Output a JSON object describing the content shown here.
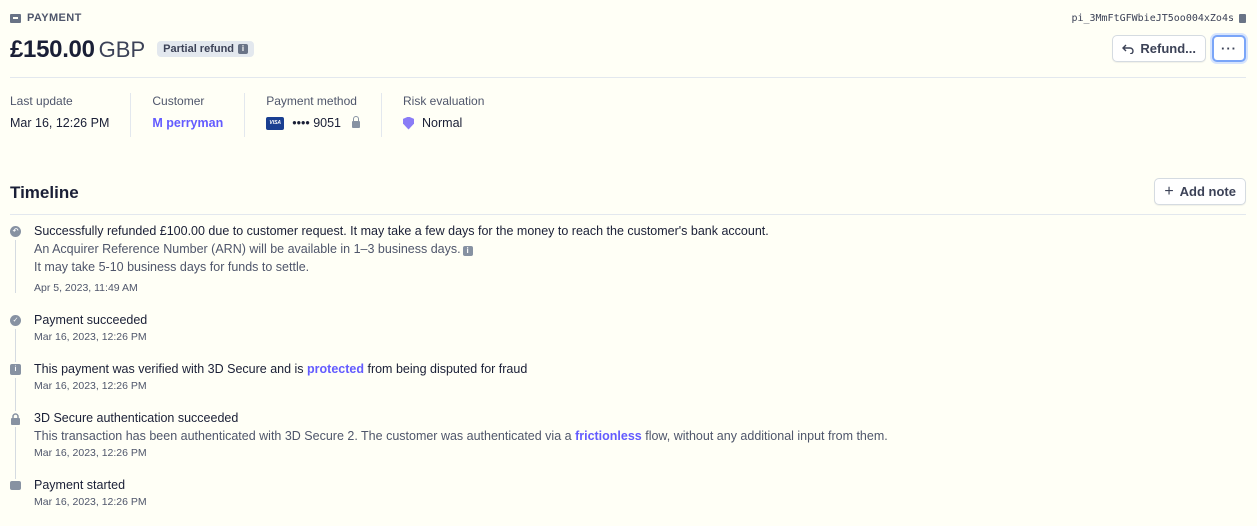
{
  "header": {
    "kind_label": "PAYMENT",
    "amount": "£150.00",
    "currency": "GBP",
    "status_badge": "Partial refund",
    "payment_id": "pi_3MmFtGFWbieJT5oo004xZo4s",
    "refund_label": "Refund...",
    "more_label": "···"
  },
  "summary": {
    "last_update": {
      "label": "Last update",
      "value": "Mar 16, 12:26 PM"
    },
    "customer": {
      "label": "Customer",
      "value": "M perryman"
    },
    "payment_method": {
      "label": "Payment method",
      "brand": "VISA",
      "value": "•••• 9051"
    },
    "risk": {
      "label": "Risk evaluation",
      "value": "Normal"
    }
  },
  "timeline": {
    "title": "Timeline",
    "add_note_label": "Add note",
    "events": [
      {
        "main": "Successfully refunded £100.00 due to customer request. It may take a few days for the money to reach the customer's bank account.",
        "sub1": "An Acquirer Reference Number (ARN) will be available in 1–3 business days.",
        "sub2": "It may take 5-10 business days for funds to settle.",
        "date": "Apr 5, 2023, 11:49 AM"
      },
      {
        "main": "Payment succeeded",
        "date": "Mar 16, 2023, 12:26 PM"
      },
      {
        "main_pre": "This payment was verified with 3D Secure and is ",
        "main_link": "protected",
        "main_post": " from being disputed for fraud",
        "date": "Mar 16, 2023, 12:26 PM"
      },
      {
        "main": "3D Secure authentication succeeded",
        "sub_pre": "This transaction has been authenticated with 3D Secure 2. The customer was authenticated via a ",
        "sub_link": "frictionless",
        "sub_post": " flow, without any additional input from them.",
        "date": "Mar 16, 2023, 12:26 PM"
      },
      {
        "main": "Payment started",
        "date": "Mar 16, 2023, 12:26 PM"
      }
    ]
  },
  "colors": {
    "background": "#fffff6",
    "link": "#635bff",
    "risk_shield": "#8a7cf6",
    "focus_ring": "#7aa5f8"
  },
  "icons": {
    "kind": "payment-card-icon",
    "copy": "clipboard-icon",
    "refund": "undo-arrow-icon",
    "risk": "shield-icon",
    "lock": "lock-icon"
  }
}
